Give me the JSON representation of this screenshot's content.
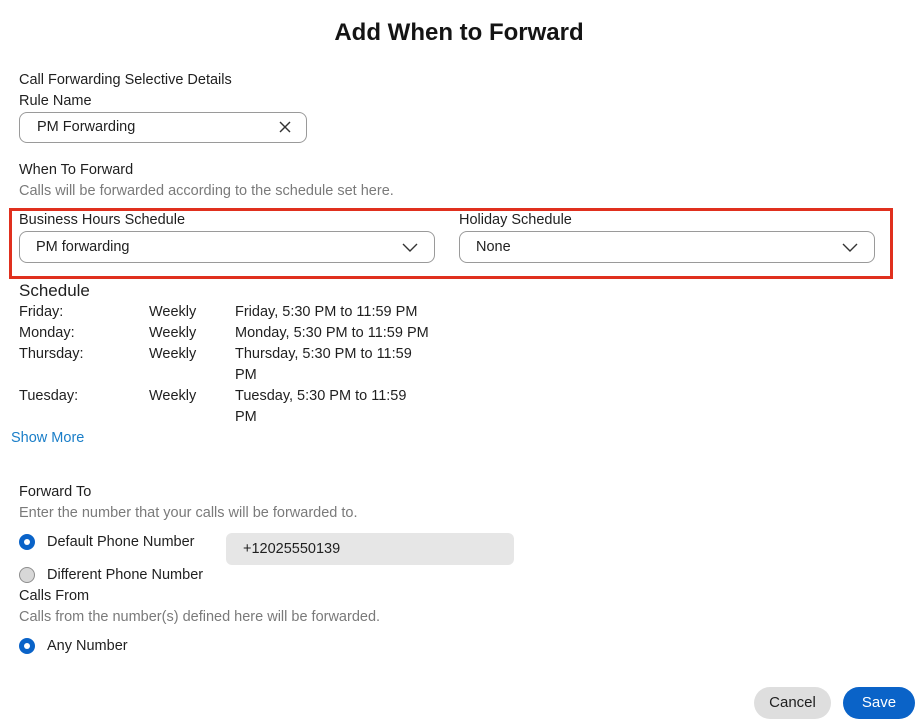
{
  "dialog": {
    "title": "Add When to Forward"
  },
  "details": {
    "section_label": "Call Forwarding Selective Details",
    "rule_name_label": "Rule Name",
    "rule_name_value": "PM Forwarding"
  },
  "when_to_forward": {
    "heading": "When To Forward",
    "hint": "Calls will be forwarded according to the schedule set here.",
    "business_hours_label": "Business Hours Schedule",
    "business_hours_value": "PM forwarding",
    "holiday_label": "Holiday Schedule",
    "holiday_value": "None"
  },
  "schedule": {
    "heading": "Schedule",
    "rows": [
      {
        "day": "Friday:",
        "frequency": "Weekly",
        "detail_line1": "Friday, 5:30 PM to 11:59 PM",
        "detail_line2": ""
      },
      {
        "day": "Monday:",
        "frequency": "Weekly",
        "detail_line1": "Monday, 5:30 PM to 11:59 PM",
        "detail_line2": ""
      },
      {
        "day": "Thursday:",
        "frequency": "Weekly",
        "detail_line1": "Thursday, 5:30 PM to 11:59",
        "detail_line2": "PM"
      },
      {
        "day": "Tuesday:",
        "frequency": "Weekly",
        "detail_line1": "Tuesday, 5:30 PM to 11:59",
        "detail_line2": "PM"
      }
    ],
    "show_more_label": "Show More"
  },
  "forward_to": {
    "heading": "Forward To",
    "hint": "Enter the number that your calls will be forwarded to.",
    "default_option_label": "Default Phone Number",
    "default_selected": true,
    "default_number": "+12025550139",
    "different_option_label": "Different Phone Number",
    "different_selected": false
  },
  "calls_from": {
    "heading": "Calls From",
    "hint": "Calls from the number(s) defined here will be forwarded.",
    "any_number_label": "Any Number",
    "any_number_selected": true
  },
  "footer": {
    "cancel_label": "Cancel",
    "save_label": "Save"
  },
  "colors": {
    "accent": "#0a63c8",
    "highlight_border": "#e0301e",
    "link": "#1a7ec8"
  },
  "icons": {
    "clear": "close-icon",
    "dropdown": "chevron-down-icon"
  }
}
